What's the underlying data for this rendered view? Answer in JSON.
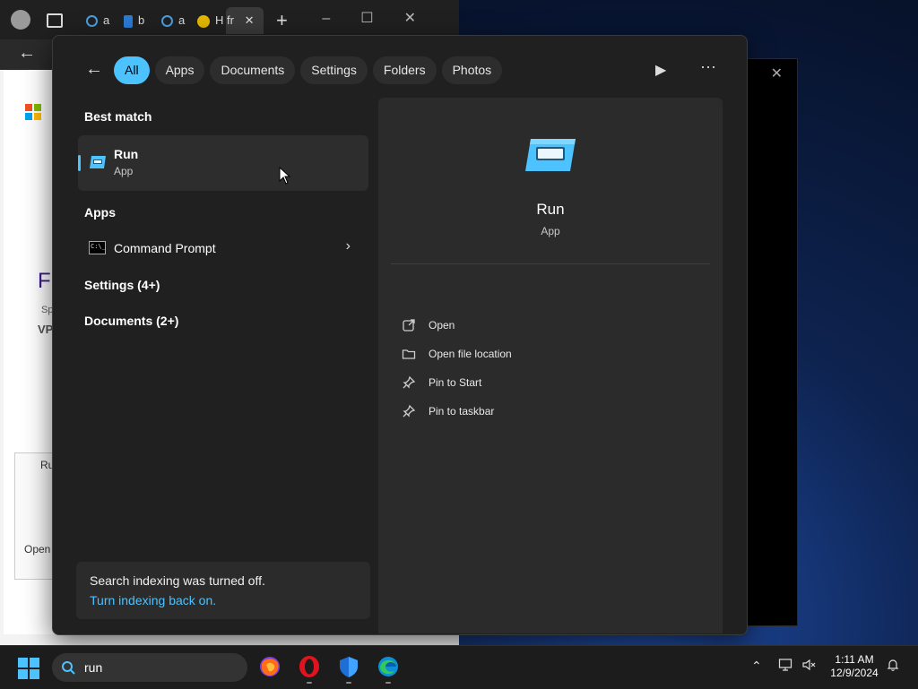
{
  "browser": {
    "tab_labels": [
      "a",
      "b",
      "a",
      "H fr"
    ],
    "page_fragments": [
      "F",
      "Sp",
      "VP",
      "Ru",
      "Open"
    ]
  },
  "search": {
    "filters": [
      {
        "label": "All",
        "active": true
      },
      {
        "label": "Apps",
        "active": false
      },
      {
        "label": "Documents",
        "active": false
      },
      {
        "label": "Settings",
        "active": false
      },
      {
        "label": "Folders",
        "active": false
      },
      {
        "label": "Photos",
        "active": false
      }
    ],
    "best_match_label": "Best match",
    "best_match": {
      "title": "Run",
      "subtitle": "App"
    },
    "apps_label": "Apps",
    "apps": [
      {
        "label": "Command Prompt"
      }
    ],
    "settings_group": "Settings (4+)",
    "documents_group": "Documents (2+)",
    "indexing": {
      "message": "Search indexing was turned off.",
      "link": "Turn indexing back on."
    }
  },
  "preview": {
    "name": "Run",
    "type": "App",
    "actions": [
      {
        "label": "Open",
        "icon": "open-external-icon"
      },
      {
        "label": "Open file location",
        "icon": "folder-icon"
      },
      {
        "label": "Pin to Start",
        "icon": "pin-icon"
      },
      {
        "label": "Pin to taskbar",
        "icon": "pin-icon"
      }
    ]
  },
  "taskbar": {
    "search_value": "run",
    "apps": [
      "firefox-icon",
      "opera-icon",
      "defender-icon",
      "edge-icon"
    ],
    "time": "1:11 AM",
    "date": "12/9/2024"
  },
  "colors": {
    "accent": "#4cc2ff",
    "panel_bg": "#202020",
    "preview_bg": "#2b2b2b"
  }
}
